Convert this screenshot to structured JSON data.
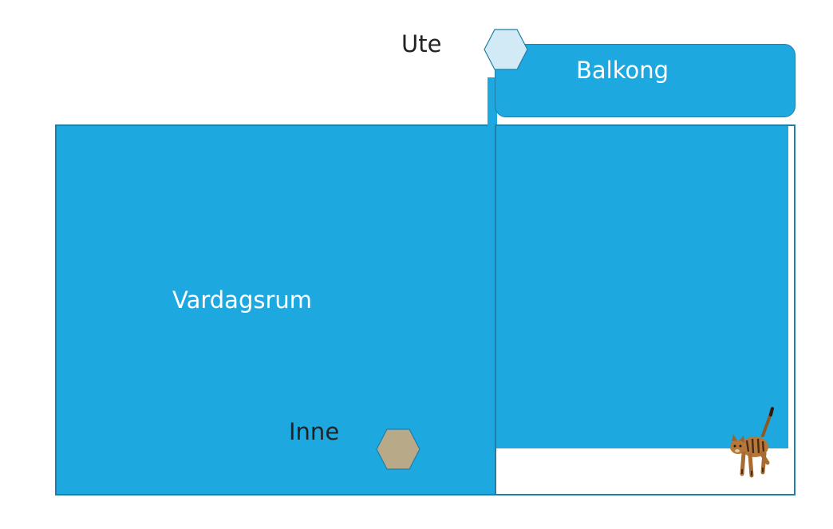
{
  "rooms": {
    "vardagsrum": "Vardagsrum",
    "balkong": "Balkong"
  },
  "labels": {
    "ute": "Ute",
    "inne": "Inne"
  },
  "colors": {
    "room_fill": "#1ea8e0",
    "room_border": "#1f7fa8",
    "ute_hex": "#d2eaf5",
    "inne_hex": "#b8a988"
  },
  "icons": {
    "cat": "cat-icon"
  }
}
